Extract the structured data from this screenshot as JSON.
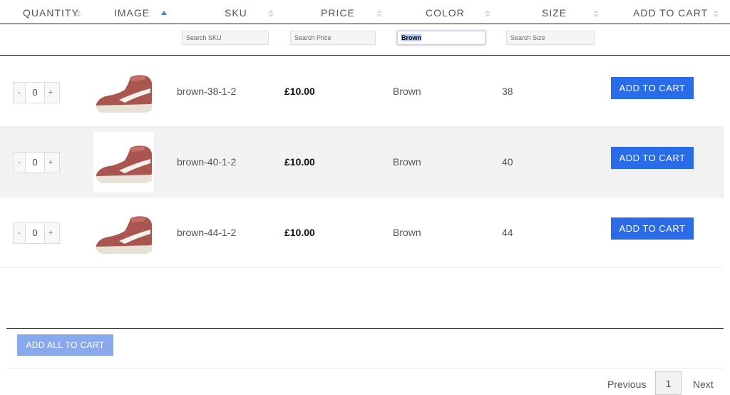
{
  "header": {
    "columns": [
      {
        "label": "QUANTITY"
      },
      {
        "label": "IMAGE"
      },
      {
        "label": "SKU"
      },
      {
        "label": "PRICE"
      },
      {
        "label": "COLOR"
      },
      {
        "label": "SIZE"
      },
      {
        "label": "ADD TO CART"
      }
    ]
  },
  "filters": {
    "sku_placeholder": "Search SKU",
    "price_placeholder": "Search Price",
    "color_value": "Brown",
    "size_placeholder": "Search Size"
  },
  "rows": [
    {
      "qty": "0",
      "sku": "brown-38-1-2",
      "price": "£10.00",
      "color": "Brown",
      "size": "38",
      "button": "ADD TO CART"
    },
    {
      "qty": "0",
      "sku": "brown-40-1-2",
      "price": "£10.00",
      "color": "Brown",
      "size": "40",
      "button": "ADD TO CART"
    },
    {
      "qty": "0",
      "sku": "brown-44-1-2",
      "price": "£10.00",
      "color": "Brown",
      "size": "44",
      "button": "ADD TO CART"
    }
  ],
  "qty_controls": {
    "minus": "-",
    "plus": "+"
  },
  "footer": {
    "add_all_label": "ADD ALL TO CART"
  },
  "pagination": {
    "previous": "Previous",
    "current_page": "1",
    "next": "Next"
  },
  "colors": {
    "accent": "#2a6be8",
    "accent_light": "#8aa9ec",
    "row_alt": "#f2f2f2",
    "sort_active": "#4a7fe0"
  }
}
